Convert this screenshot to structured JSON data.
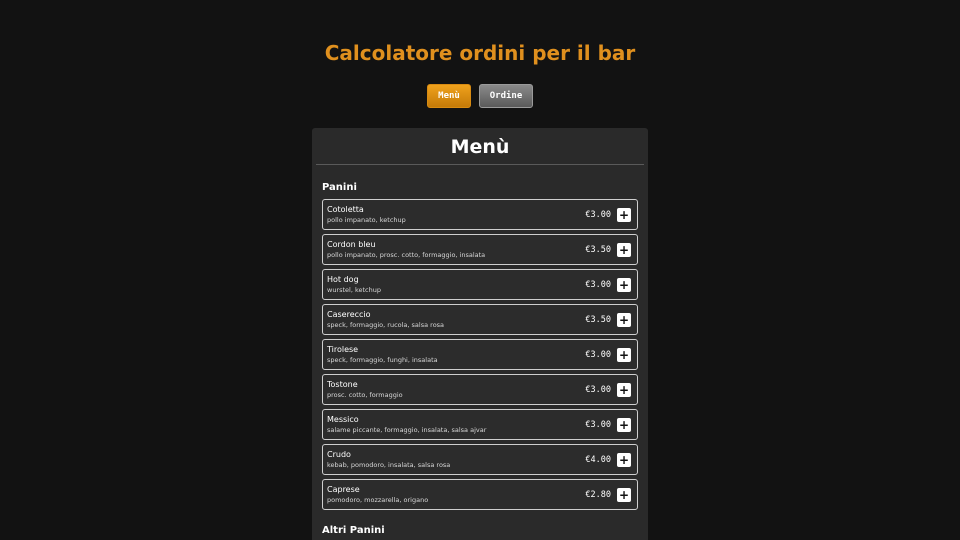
{
  "app_title": "Calcolatore ordini per il bar",
  "tabs": {
    "menu_label": "Menù",
    "order_label": "Ordine"
  },
  "panel": {
    "title": "Menù"
  },
  "sections": {
    "panini": {
      "title": "Panini",
      "items": [
        {
          "name": "Cotoletta",
          "desc": "pollo impanato, ketchup",
          "price": "€3.00"
        },
        {
          "name": "Cordon bleu",
          "desc": "pollo impanato, prosc. cotto, formaggio, insalata",
          "price": "€3.50"
        },
        {
          "name": "Hot dog",
          "desc": "wurstel, ketchup",
          "price": "€3.00"
        },
        {
          "name": "Casereccio",
          "desc": "speck, formaggio, rucola, salsa rosa",
          "price": "€3.50"
        },
        {
          "name": "Tirolese",
          "desc": "speck, formaggio, funghi, insalata",
          "price": "€3.00"
        },
        {
          "name": "Tostone",
          "desc": "prosc. cotto, formaggio",
          "price": "€3.00"
        },
        {
          "name": "Messico",
          "desc": "salame piccante, formaggio, insalata, salsa ajvar",
          "price": "€3.00"
        },
        {
          "name": "Crudo",
          "desc": "kebab, pomodoro, insalata, salsa rosa",
          "price": "€4.00"
        },
        {
          "name": "Caprese",
          "desc": "pomodoro, mozzarella, origano",
          "price": "€2.80"
        }
      ]
    },
    "altri_panini": {
      "title": "Altri Panini"
    }
  },
  "icons": {
    "add": "plus-icon"
  },
  "colors": {
    "accent": "#e0901e",
    "background": "#121212",
    "panel": "#2a2a2a"
  }
}
